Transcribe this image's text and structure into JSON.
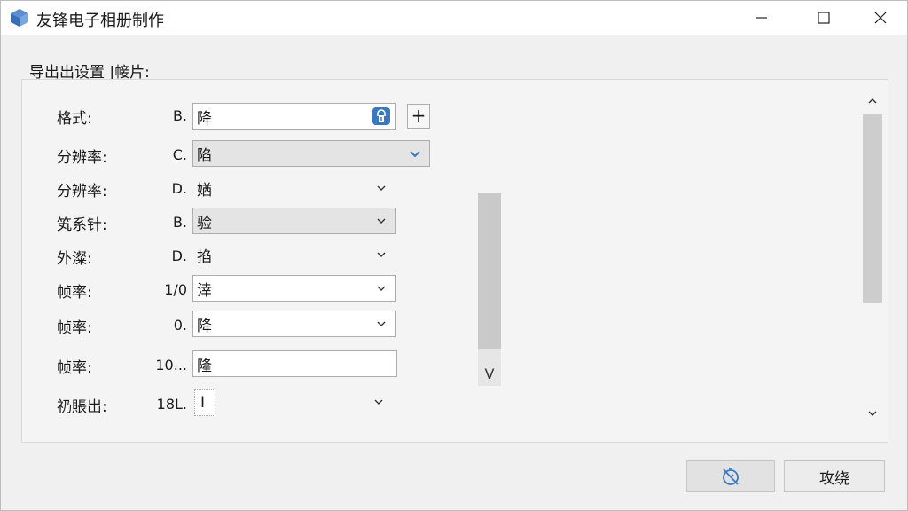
{
  "window": {
    "title": "友锋电子相册制作"
  },
  "panel": {
    "caption": "导出出设置 |帹片:"
  },
  "rows": [
    {
      "label": "格式:",
      "prefix": "B.",
      "value": "降"
    },
    {
      "label": "分辨率:",
      "prefix": "C.",
      "value": "陷"
    },
    {
      "label": "分辨率:",
      "prefix": "D.",
      "value": "媨"
    },
    {
      "label": "笂系针:",
      "prefix": "B.",
      "value": "验"
    },
    {
      "label": "外澯:",
      "prefix": "D.",
      "value": "掐"
    },
    {
      "label": "帧率:",
      "prefix": "1/0",
      "value": "涬"
    },
    {
      "label": "帧率:",
      "prefix": "0.",
      "value": "降"
    },
    {
      "label": "帧率:",
      "prefix": "10...",
      "value": "隆"
    },
    {
      "label": "礽賬岀:",
      "prefix": "18L.",
      "value": "I"
    }
  ],
  "buttons": {
    "add": "+",
    "cancel": "攻绕"
  },
  "scroll": {
    "inner_down": "V"
  },
  "colors": {
    "accent": "#3a78c0"
  }
}
